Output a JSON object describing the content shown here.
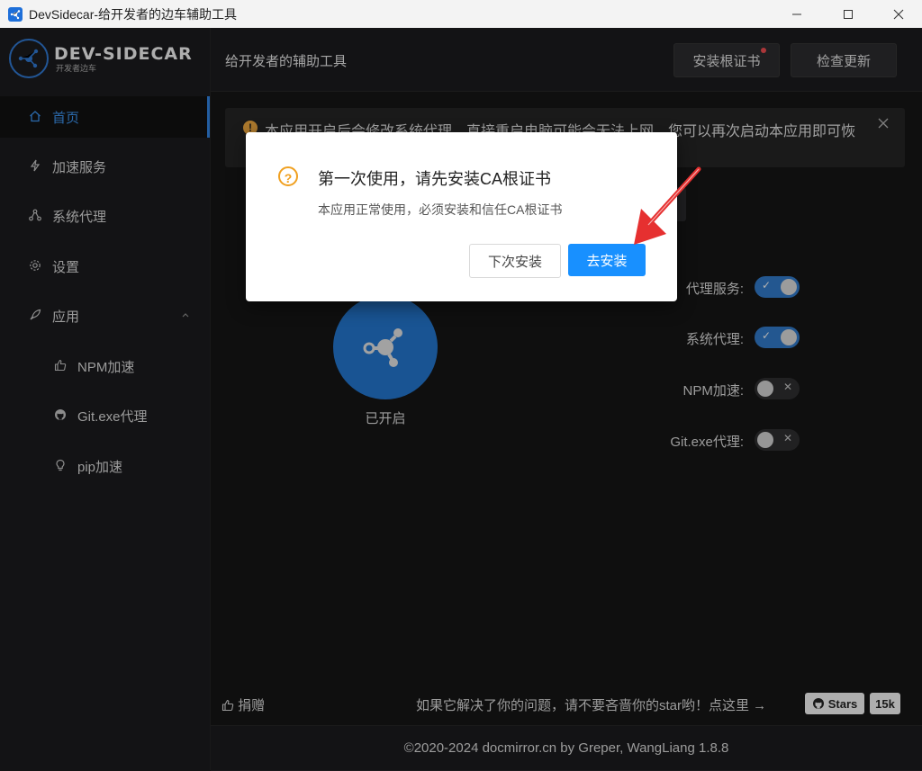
{
  "window": {
    "title": "DevSidecar-给开发者的边车辅助工具"
  },
  "sidebar": {
    "logo_text": "DEV-SIDECAR",
    "logo_sub": "开发者边车",
    "items": [
      {
        "label": "首页",
        "icon": "home-icon"
      },
      {
        "label": "加速服务",
        "icon": "lightning-icon"
      },
      {
        "label": "系统代理",
        "icon": "network-icon"
      },
      {
        "label": "设置",
        "icon": "gear-icon"
      },
      {
        "label": "应用",
        "icon": "rocket-icon"
      },
      {
        "label": "NPM加速",
        "icon": "thumbs-up-icon"
      },
      {
        "label": "Git.exe代理",
        "icon": "github-icon"
      },
      {
        "label": "pip加速",
        "icon": "bulb-icon"
      }
    ]
  },
  "header": {
    "title": "给开发者的辅助工具",
    "install_cert_label": "安装根证书",
    "check_update_label": "检查更新"
  },
  "alert": {
    "text": "本应用开启后会修改系统代理，直接重启电脑可能会无法上网，您可以再次启动本应用即可恢"
  },
  "status": {
    "started_label": "已开启"
  },
  "switches": [
    {
      "label": "代理服务:",
      "state": "on"
    },
    {
      "label": "系统代理:",
      "state": "on"
    },
    {
      "label": "NPM加速:",
      "state": "off"
    },
    {
      "label": "Git.exe代理:",
      "state": "off"
    }
  ],
  "footer": {
    "donate_label": "捐赠",
    "star_hint": "如果它解决了你的问题，请不要吝啬你的star哟！点这里 →",
    "stars_label": "Stars",
    "stars_count": "15k",
    "copyright": "©2020-2024 docmirror.cn by Greper, WangLiang 1.8.8"
  },
  "modal": {
    "title": "第一次使用，请先安装CA根证书",
    "content": "本应用正常使用，必须安装和信任CA根证书",
    "later_label": "下次安装",
    "install_label": "去安装"
  },
  "colors": {
    "accent": "#1890ff",
    "warning": "#f0a020",
    "switch_on": "#2f74c0",
    "badge": "#e5484d"
  }
}
